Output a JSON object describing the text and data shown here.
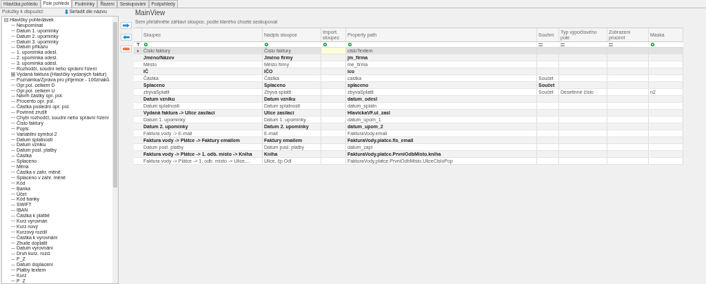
{
  "tabs": [
    {
      "label": "Hlavička pohledu",
      "selected": false
    },
    {
      "label": "Pole pohledu",
      "selected": true
    },
    {
      "label": "Podmínky",
      "selected": false
    },
    {
      "label": "Řazení",
      "selected": false
    },
    {
      "label": "Seskupování",
      "selected": false
    },
    {
      "label": "Podpohledy",
      "selected": false
    }
  ],
  "fields_panel": {
    "label": "Položky k dispozici:",
    "sort_button": "Seřadit dle názvu",
    "tree": [
      {
        "label": "Hlavičky pohledávek",
        "expanded": true,
        "children": [
          {
            "label": "Neupomínat"
          },
          {
            "label": "Datum 1. upomínky"
          },
          {
            "label": "Datum 2. upomínky"
          },
          {
            "label": "Datum 3. upomínky"
          },
          {
            "label": "Datum příkazu"
          },
          {
            "label": "1. upomínka odesl."
          },
          {
            "label": "2. upomínka odesl."
          },
          {
            "label": "3. upomínka odesl."
          },
          {
            "label": "Rozhodčí, soudní nebo správní řízení"
          },
          {
            "label": "Vydaná faktura (Hlavičky vydaných faktur)",
            "expanded": false
          },
          {
            "label": "Poznámka/Zpráva pro příjemce - 100znaků."
          },
          {
            "label": "Opr.pol. celkem D"
          },
          {
            "label": "Opr.pol. celkem U"
          },
          {
            "label": "Návrh částky opr. pol."
          },
          {
            "label": "Procento opr. pol."
          },
          {
            "label": "Částka poslední opr. pol."
          },
          {
            "label": "Povinné zrušit"
          },
          {
            "label": "Chybí rozhodčí, soudní nebo správní řízení"
          },
          {
            "label": "Číslo faktury"
          },
          {
            "label": "Popis"
          },
          {
            "label": "Variabilní symbol 2"
          },
          {
            "label": "Datum splatnosti"
          },
          {
            "label": "Datum vzniku"
          },
          {
            "label": "Datum posl. platby"
          },
          {
            "label": "Částka"
          },
          {
            "label": "Splaceno"
          },
          {
            "label": "Měna"
          },
          {
            "label": "Částka v zahr. měně"
          },
          {
            "label": "Splaceno v zahr. měně"
          },
          {
            "label": "Kód"
          },
          {
            "label": "Banka"
          },
          {
            "label": "Účet"
          },
          {
            "label": "Kód banky"
          },
          {
            "label": "SWIFT"
          },
          {
            "label": "IBAN"
          },
          {
            "label": "Částka k platbě"
          },
          {
            "label": "Kurz vyrovnán"
          },
          {
            "label": "Kurz nový"
          },
          {
            "label": "Kurzový rozdíl"
          },
          {
            "label": "Částka k vyrovnání"
          },
          {
            "label": "Zbude doplatit"
          },
          {
            "label": "Datum vyrovnání"
          },
          {
            "label": "Druh kurz. rozd."
          },
          {
            "label": "P_Z"
          },
          {
            "label": "Datum doplacení"
          },
          {
            "label": "Platby textem"
          },
          {
            "label": "Kurz"
          },
          {
            "label": "P_Z"
          }
        ]
      }
    ]
  },
  "transfer_buttons": [
    {
      "kind": "add"
    },
    {
      "kind": "remove"
    },
    {
      "kind": "delete"
    }
  ],
  "grid": {
    "title": "MainView",
    "group_hint": "Sem přetáhněte záhlaví sloupce, podle kterého chcete seskupovat",
    "columns": [
      {
        "label": "Sloupec",
        "kind": "text"
      },
      {
        "label": "Nadpis sloupce",
        "kind": "text"
      },
      {
        "label": "Import. sloupec",
        "kind": "text"
      },
      {
        "label": "Property path",
        "kind": "text"
      },
      {
        "label": "Souhrn",
        "kind": "equals"
      },
      {
        "label": "Typ výpočtového pole",
        "kind": "equals"
      },
      {
        "label": "Zobrazení procent",
        "kind": "equals"
      },
      {
        "label": "Maska",
        "kind": "text"
      }
    ],
    "rows": [
      {
        "selected": true,
        "bold": false,
        "column": "Číslo faktury",
        "caption": "Číslo faktury",
        "property_path": "cisloTextem"
      },
      {
        "selected": false,
        "bold": true,
        "column": "Jméno/Název",
        "caption": "Jméno firmy",
        "property_path": "jm_firma"
      },
      {
        "selected": false,
        "bold": false,
        "column": "Město",
        "caption": "Město firmy",
        "property_path": "me_firma"
      },
      {
        "selected": false,
        "bold": true,
        "column": "IČ",
        "caption": "IČO",
        "property_path": "ico"
      },
      {
        "selected": false,
        "bold": false,
        "column": "Částka",
        "caption": "Částka",
        "property_path": "castka",
        "summary": "Součet"
      },
      {
        "selected": false,
        "bold": true,
        "column": "Splaceno",
        "caption": "Splaceno",
        "property_path": "splaceno",
        "summary": "Součet"
      },
      {
        "selected": false,
        "bold": false,
        "column": "zbyvaSplatit",
        "caption": "Zbývá splatit",
        "property_path": "zbyvaSplatit",
        "summary": "Součet",
        "calc_type": "Desetinné číslo",
        "mask": "n2"
      },
      {
        "selected": false,
        "bold": true,
        "column": "Datum vzniku",
        "caption": "Datum vzniku",
        "property_path": "datum_odesl"
      },
      {
        "selected": false,
        "bold": false,
        "column": "Datum splatnosti",
        "caption": "Datum splatnosti",
        "property_path": "datum_splatn"
      },
      {
        "selected": false,
        "bold": true,
        "column": "Vydaná faktura -> Ulice zasílací",
        "caption": "Ulice zasílací",
        "property_path": "HlavickaVF.ul_zasl"
      },
      {
        "selected": false,
        "bold": false,
        "column": "Datum 1. upomínky",
        "caption": "Datum 1. upomínky",
        "property_path": "datum_upom_1"
      },
      {
        "selected": false,
        "bold": true,
        "column": "Datum 2. upomínky",
        "caption": "Datum 2. upomínky",
        "property_path": "datum_upom_2"
      },
      {
        "selected": false,
        "bold": false,
        "column": "Faktura vody -> E-mail",
        "caption": "E-mail",
        "property_path": "FakturaVody.email"
      },
      {
        "selected": false,
        "bold": true,
        "column": "Faktura vody -> Plátce -> Faktury emailem",
        "caption": "Faktury emailem",
        "property_path": "FakturaVody.platce.fis_email"
      },
      {
        "selected": false,
        "bold": false,
        "column": "Datum posl. platby",
        "caption": "Datum posl. platby",
        "property_path": "datum_zapl"
      },
      {
        "selected": false,
        "bold": true,
        "column": "Faktura vody -> Plátce -> 1. odb. místo -> Kniha",
        "caption": "Kniha",
        "property_path": "FakturaVody.platce.PrvniOdbMisto.kniha"
      },
      {
        "selected": false,
        "bold": false,
        "column": "Faktura vody -> Plátce -> 1. odb. místo -> Ulice,...",
        "caption": "Ulice, čp Odl",
        "property_path": "FakturaVody.platce.PrvniOdbMisto.UliceCisloPop"
      }
    ]
  }
}
